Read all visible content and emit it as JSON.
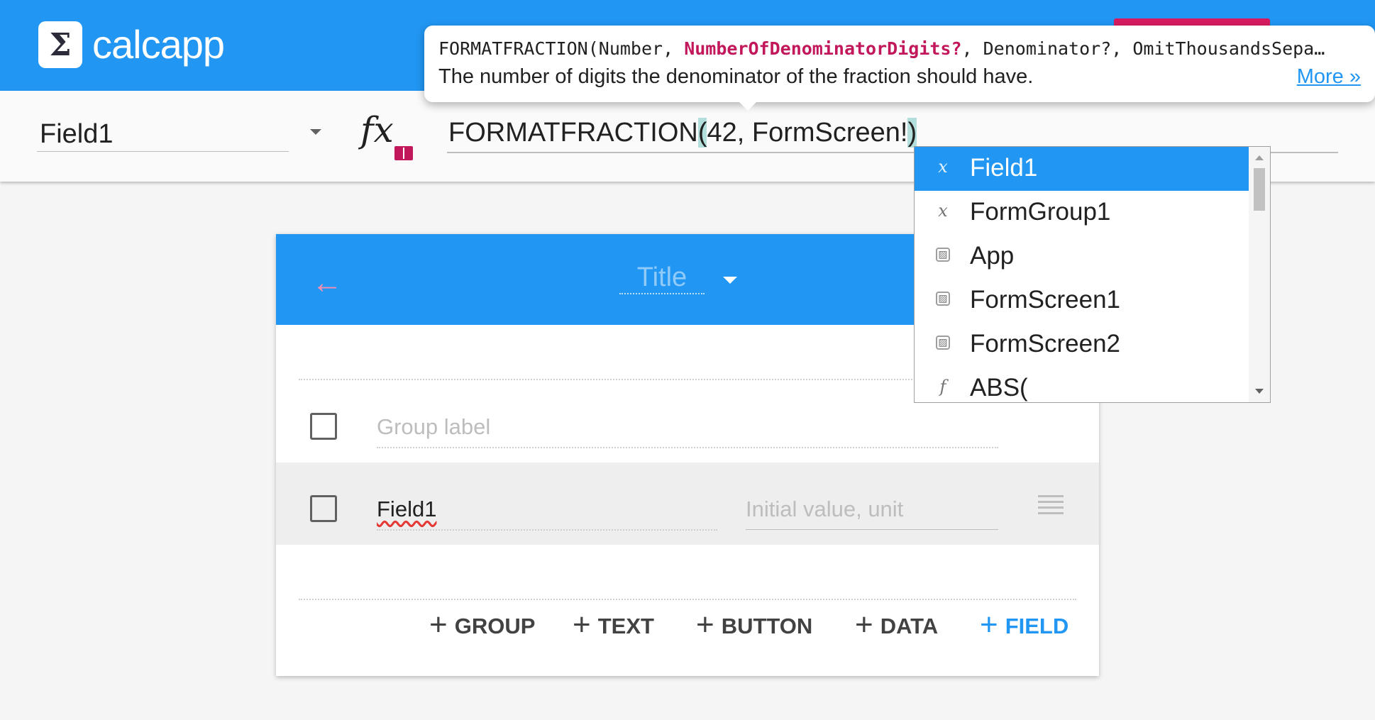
{
  "app": {
    "logo_glyph": "Σ",
    "name": "calcapp"
  },
  "formula_bar": {
    "field_select_value": "Field1",
    "fx_label": "fx",
    "formula_prefix": "FORMATFRACTION",
    "formula_paren_open": "(",
    "formula_middle": "42, FormScreen!",
    "formula_paren_close": ")"
  },
  "tooltip": {
    "sig_prefix": "FORMATFRACTION(Number, ",
    "sig_active": "NumberOfDenominatorDigits?",
    "sig_suffix": ", Denominator?, OmitThousandsSepa…",
    "description": "The number of digits the denominator of the fraction should have.",
    "more_link": "More »"
  },
  "card": {
    "back_glyph": "←",
    "title_placeholder": "Title",
    "group_label_placeholder": "Group label",
    "field_label": "Field1",
    "initial_value_placeholder": "Initial value, unit",
    "add_buttons": {
      "plus": "+",
      "group": "GROUP",
      "text": "TEXT",
      "button": "BUTTON",
      "data": "DATA",
      "field": "FIELD"
    }
  },
  "autocomplete": {
    "items": [
      {
        "icon": "x",
        "label": "Field1"
      },
      {
        "icon": "x",
        "label": "FormGroup1"
      },
      {
        "icon": "▨",
        "label": "App"
      },
      {
        "icon": "▨",
        "label": "FormScreen1"
      },
      {
        "icon": "▨",
        "label": "FormScreen2"
      },
      {
        "icon": "f",
        "label": "ABS("
      }
    ]
  },
  "colors": {
    "primary": "#2196f3",
    "accent": "#c2185b",
    "highlight": "#b2dfdb"
  }
}
